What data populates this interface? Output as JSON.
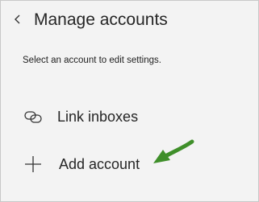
{
  "header": {
    "back_icon": "chevron-left-icon",
    "title": "Manage accounts"
  },
  "description": "Select an account to edit settings.",
  "menu": {
    "items": [
      {
        "label": "Link inboxes",
        "icon": "link-icon"
      },
      {
        "label": "Add account",
        "icon": "plus-icon"
      }
    ]
  },
  "colors": {
    "panel_background": "#f3f3f3",
    "text": "#262626",
    "annotation_arrow": "#3f8f2a"
  }
}
